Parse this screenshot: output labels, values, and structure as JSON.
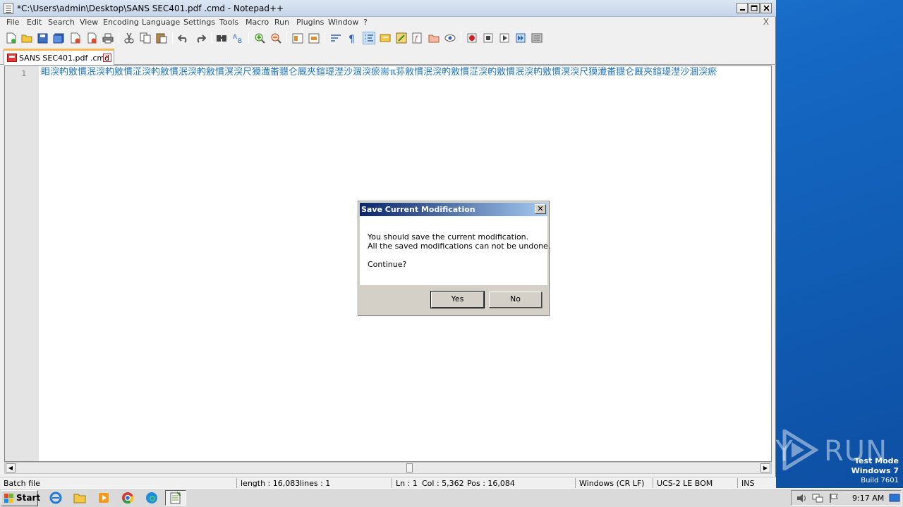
{
  "window": {
    "title": "*C:\\Users\\admin\\Desktop\\SANS SEC401.pdf .cmd - Notepad++",
    "minimize": "_",
    "maximize": "□",
    "close": "✕"
  },
  "menu": {
    "items": [
      "File",
      "Edit",
      "Search",
      "View",
      "Encoding",
      "Language",
      "Settings",
      "Tools",
      "Macro",
      "Run",
      "Plugins",
      "Window",
      "?"
    ],
    "close_label": "X"
  },
  "toolbar": {
    "icons": [
      "new-file-icon",
      "open-file-icon",
      "save-icon",
      "save-all-icon",
      "close-icon",
      "close-all-icon",
      "print-icon",
      "cut-icon",
      "copy-icon",
      "paste-icon",
      "undo-icon",
      "redo-icon",
      "find-icon",
      "replace-icon",
      "zoom-in-icon",
      "zoom-out-icon",
      "sync-vertical-icon",
      "sync-horizontal-icon",
      "word-wrap-icon",
      "show-all-characters-icon",
      "indent-guide-icon",
      "user-language-icon",
      "document-map-icon",
      "function-list-icon",
      "folder-as-workspace-icon",
      "monitoring-icon",
      "record-macro-icon",
      "stop-macro-icon",
      "play-macro-icon",
      "run-macro-multiple-icon",
      "save-macro-icon"
    ]
  },
  "tab": {
    "label": "SANS SEC401.pdf .cmd",
    "close": "✕"
  },
  "editor": {
    "line_number": "1",
    "content": "䀠湥畃敫慣泯湥畃敫慣淽湥畃敫慣泯湥畃敫慣溟湥尺獏瀐畨䎚仑厩夾鍹瑅漜沙涸湥瘀耑ℼ荪敫慣泯湥畃敫慣淽湥畃敫慣泯湥畃敫慣溟湥尺獏瀐畨䎚仑厩夾鍹瑅漜沙涸湥瘀"
  },
  "status": {
    "file_type": "Batch file",
    "length": "length : 16,083",
    "lines": "lines : 1",
    "ln": "Ln : 1",
    "col": "Col : 5,362",
    "pos": "Pos : 16,084",
    "eol": "Windows (CR LF)",
    "encoding": "UCS-2 LE BOM",
    "mode": "INS"
  },
  "dialog": {
    "title": "Save Current Modification",
    "line1": "You should save the current modification.",
    "line2": "All the saved modifications can not be undone.",
    "line3": "Continue?",
    "yes": "Yes",
    "no": "No",
    "close": "✕"
  },
  "desktop": {
    "watermark_left": "ANY",
    "watermark_right": "RUN",
    "test_mode": "Test Mode",
    "os": "Windows 7",
    "build": "Build 7601"
  },
  "taskbar": {
    "start": "Start",
    "apps": [
      "internet-explorer-icon",
      "file-explorer-icon",
      "media-player-icon",
      "chrome-icon",
      "edge-icon",
      "notepad-plus-plus-icon"
    ],
    "clock": "9:17 AM"
  },
  "colors": {
    "desktop": "#1467c2",
    "tab_accent": "#fab74f",
    "code_text": "#1c74c4",
    "dialog_title_start": "#0a246a",
    "dialog_title_end": "#a6caf0"
  }
}
